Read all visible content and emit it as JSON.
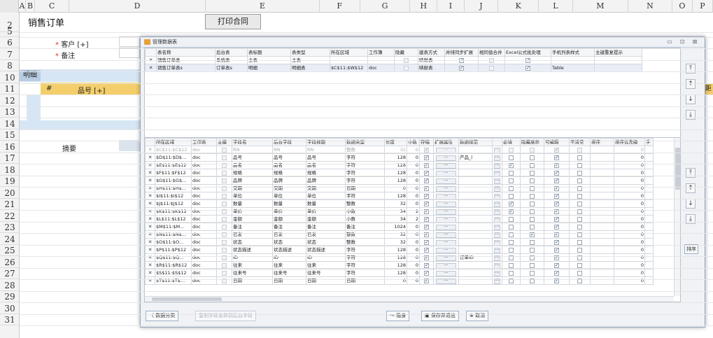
{
  "sheet": {
    "columns": [
      "A",
      "B",
      "C",
      "D",
      "E",
      "F",
      "G",
      "H",
      "I",
      "J",
      "K",
      "L",
      "M",
      "N",
      "O",
      "P"
    ],
    "rows": [
      "2",
      "5",
      "6",
      "7",
      "8",
      "10",
      "11",
      "12",
      "13",
      "14",
      "15",
      "16",
      "17",
      "18",
      "19",
      "20",
      "21",
      "22",
      "23",
      "24",
      "25",
      "26",
      "27",
      "28",
      "29",
      "30",
      "31"
    ],
    "title": "销售订单",
    "print_button": "打印合同",
    "customer_label": "客户 [+]",
    "note_label": "备注",
    "required_mark": "*",
    "detail_tag": "明细",
    "detail_hash": "#",
    "detail_item": "品号 [+]",
    "summary_label": "摘要",
    "right_edge_char": "距"
  },
  "dialog": {
    "title": "管理数据表",
    "win_buttons": [
      "▭",
      "⊡",
      "⊠"
    ],
    "table_headers": [
      "",
      "表名称",
      "后台表",
      "表标题",
      "表类型",
      "所在区域",
      "工作簿",
      "隐藏",
      "建表方式",
      "并排同步扩展",
      "相同值合并",
      "Excel公式批处理",
      "手机列表样式",
      "主键重复提示"
    ],
    "tables": [
      {
        "x": "✕",
        "name": "销售订单表",
        "backend": "系统表",
        "caption": "主表",
        "type": "主表",
        "area": "",
        "book": "",
        "hidden": false,
        "mode": "映射表",
        "sync": true,
        "merge": false,
        "excel": true,
        "mobile": "",
        "dup": ""
      },
      {
        "x": "✕",
        "name": "销售订单表s",
        "backend": "订单表s",
        "caption": "明细",
        "type": "明细表",
        "area": "$C$11:$W$12",
        "book": "doc",
        "hidden": false,
        "mode": "映射表",
        "sync": true,
        "merge": false,
        "excel": true,
        "mobile": "Table",
        "dup": ""
      }
    ],
    "side_buttons_top": [
      "⤒",
      "↑",
      "↓",
      "⤓"
    ],
    "field_headers": [
      "",
      "所在区域",
      "工作表",
      "主键",
      "字段名",
      "后台字段",
      "字段标题",
      "数据类型",
      "长度",
      "小数",
      "存储",
      "扩展属性",
      "数据规范",
      "",
      "必填",
      "隐藏展示",
      "可编辑",
      "不清空",
      "排序",
      "排序优先级",
      "手"
    ],
    "fields": [
      {
        "area": "$C$11:$C$12",
        "sheet": "doc",
        "pk": false,
        "name": "RN",
        "back": "RN",
        "cap": "RN",
        "dtype": "整数",
        "len": "32",
        "dec": "0",
        "store": true,
        "spec": "",
        "req": false,
        "hide": false,
        "edit": true,
        "keep": false,
        "prio": "0",
        "grey": true
      },
      {
        "area": "$D$11:$D$...",
        "sheet": "doc",
        "pk": false,
        "name": "品号",
        "back": "品号",
        "cap": "品号",
        "dtype": "字符",
        "len": "128",
        "dec": "0",
        "store": true,
        "spec": "产品_l",
        "req": false,
        "hide": false,
        "edit": true,
        "keep": false,
        "prio": "0"
      },
      {
        "area": "$E$11:$E$12",
        "sheet": "doc",
        "pk": false,
        "name": "品名",
        "back": "品名",
        "cap": "品名",
        "dtype": "字符",
        "len": "128",
        "dec": "0",
        "store": true,
        "spec": "",
        "req": true,
        "hide": false,
        "edit": true,
        "keep": false,
        "prio": "0"
      },
      {
        "area": "$F$11:$F$12",
        "sheet": "doc",
        "pk": false,
        "name": "规格",
        "back": "规格",
        "cap": "规格",
        "dtype": "字符",
        "len": "128",
        "dec": "0",
        "store": true,
        "spec": "",
        "req": false,
        "hide": false,
        "edit": true,
        "keep": false,
        "prio": "0"
      },
      {
        "area": "$G$11:$G$...",
        "sheet": "doc",
        "pk": false,
        "name": "品牌",
        "back": "品牌",
        "cap": "品牌",
        "dtype": "字符",
        "len": "128",
        "dec": "0",
        "store": true,
        "spec": "",
        "req": false,
        "hide": false,
        "edit": true,
        "keep": false,
        "prio": "0"
      },
      {
        "area": "$H$11:$H$...",
        "sheet": "doc",
        "pk": false,
        "name": "交期",
        "back": "交期",
        "cap": "交期",
        "dtype": "日期",
        "len": "0",
        "dec": "0",
        "store": true,
        "spec": "",
        "req": false,
        "hide": false,
        "edit": true,
        "keep": false,
        "prio": "0"
      },
      {
        "area": "$I$11:$I$12",
        "sheet": "doc",
        "pk": false,
        "name": "单位",
        "back": "单位",
        "cap": "单位",
        "dtype": "字符",
        "len": "128",
        "dec": "0",
        "store": true,
        "spec": "",
        "req": false,
        "hide": false,
        "edit": true,
        "keep": false,
        "prio": "0"
      },
      {
        "area": "$J$11:$J$12",
        "sheet": "doc",
        "pk": false,
        "name": "数量",
        "back": "数量",
        "cap": "数量",
        "dtype": "整数",
        "len": "32",
        "dec": "0",
        "store": true,
        "spec": "",
        "req": true,
        "hide": false,
        "edit": true,
        "keep": false,
        "prio": "0"
      },
      {
        "area": "$K$11:$K$12",
        "sheet": "doc",
        "pk": false,
        "name": "单价",
        "back": "单价",
        "cap": "单价",
        "dtype": "小数",
        "len": "34",
        "dec": "2",
        "store": true,
        "spec": "",
        "req": true,
        "hide": false,
        "edit": true,
        "keep": false,
        "prio": "0"
      },
      {
        "area": "$L$11:$L$12",
        "sheet": "doc",
        "pk": false,
        "name": "金额",
        "back": "金额",
        "cap": "金额",
        "dtype": "小数",
        "len": "34",
        "dec": "2",
        "store": true,
        "spec": "",
        "req": false,
        "hide": false,
        "edit": true,
        "keep": false,
        "prio": "0"
      },
      {
        "area": "$M$11:$M...",
        "sheet": "doc",
        "pk": false,
        "name": "备注",
        "back": "备注",
        "cap": "备注",
        "dtype": "备注",
        "len": "1024",
        "dec": "0",
        "store": true,
        "spec": "",
        "req": false,
        "hide": false,
        "edit": true,
        "keep": false,
        "prio": "0"
      },
      {
        "area": "$N$11:$N$...",
        "sheet": "doc",
        "pk": false,
        "name": "已发",
        "back": "已发",
        "cap": "已发",
        "dtype": "整数",
        "len": "32",
        "dec": "0",
        "store": true,
        "spec": "",
        "req": false,
        "hide": true,
        "edit": true,
        "keep": false,
        "prio": "0"
      },
      {
        "area": "$O$11:$O...",
        "sheet": "doc",
        "pk": false,
        "name": "状态",
        "back": "状态",
        "cap": "状态",
        "dtype": "整数",
        "len": "32",
        "dec": "0",
        "store": true,
        "spec": "",
        "req": false,
        "hide": false,
        "edit": true,
        "keep": false,
        "prio": "0"
      },
      {
        "area": "$P$11:$P$12",
        "sheet": "doc",
        "pk": false,
        "name": "状态描述",
        "back": "状态描述",
        "cap": "状态描述",
        "dtype": "字符",
        "len": "128",
        "dec": "0",
        "store": true,
        "spec": "",
        "req": false,
        "hide": false,
        "edit": true,
        "keep": false,
        "prio": "0"
      },
      {
        "area": "$Q$11:$Q...",
        "sheet": "doc",
        "pk": false,
        "name": "ID",
        "back": "ID",
        "cap": "ID",
        "dtype": "字符",
        "len": "128",
        "dec": "0",
        "store": true,
        "spec": "订单ID",
        "req": false,
        "hide": false,
        "edit": true,
        "keep": false,
        "prio": "0"
      },
      {
        "area": "$R$11:$R$12",
        "sheet": "doc",
        "pk": false,
        "name": "往来",
        "back": "往来",
        "cap": "往来",
        "dtype": "字符",
        "len": "128",
        "dec": "0",
        "store": true,
        "spec": "",
        "req": false,
        "hide": false,
        "edit": true,
        "keep": false,
        "prio": "0"
      },
      {
        "area": "$S$11:$S$12",
        "sheet": "doc",
        "pk": false,
        "name": "往来号",
        "back": "往来号",
        "cap": "往来号",
        "dtype": "字符",
        "len": "128",
        "dec": "0",
        "store": true,
        "spec": "",
        "req": false,
        "hide": false,
        "edit": true,
        "keep": false,
        "prio": "0"
      },
      {
        "area": "$T$11:$T$...",
        "sheet": "doc",
        "pk": false,
        "name": "日期",
        "back": "日期",
        "cap": "日期",
        "dtype": "日期",
        "len": "0",
        "dec": "0",
        "store": true,
        "spec": "",
        "req": false,
        "hide": false,
        "edit": true,
        "keep": false,
        "prio": "0"
      }
    ],
    "side_buttons_bottom": [
      "⤒",
      "↑",
      "↓",
      "⤓"
    ],
    "sort_button": "排序",
    "footer": {
      "data_class": "〈 数据分类",
      "copy_fields": "复制字段名称到后台字段",
      "hide": "〜 隐身",
      "save_exit": "▣ 保存并退出",
      "cancel": "⊗ 取消"
    }
  }
}
